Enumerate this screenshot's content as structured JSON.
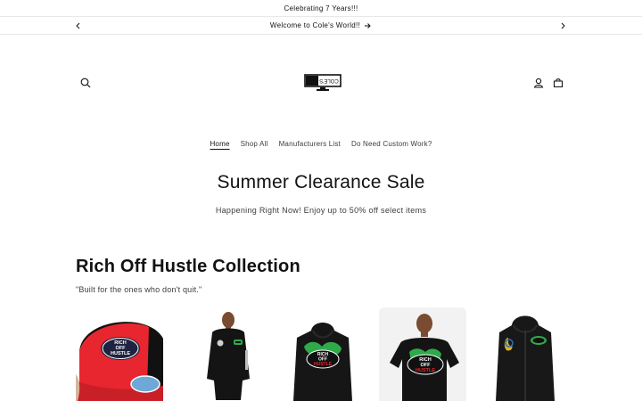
{
  "announcement_1": "Celebrating 7 Years!!!",
  "announcement_2": "Welcome to Cole's World!!",
  "nav": {
    "items": [
      {
        "label": "Home"
      },
      {
        "label": "Shop All"
      },
      {
        "label": "Manufacturers List"
      },
      {
        "label": "Do Need Custom Work?"
      }
    ]
  },
  "logo": {
    "text": "COLE'S"
  },
  "banner": {
    "title": "Summer Clearance Sale",
    "subtitle": "Happening Right Now! Enjoy up to 50% off select items"
  },
  "collection": {
    "title": "Rich Off Hustle Collection",
    "subtitle": "\"Built for the ones who don't quit.\"",
    "products": [
      {
        "name": "hat",
        "print_text": [
          "RICH",
          "OFF",
          "HUSTLE"
        ]
      },
      {
        "name": "model-hoodie-black",
        "print_text": []
      },
      {
        "name": "hoodie-black-green",
        "print_text": [
          "RICH",
          "OFF",
          "HUSTLE"
        ]
      },
      {
        "name": "model-tee-black",
        "print_text": [
          "RICH",
          "OFF",
          "HUSTLE"
        ]
      },
      {
        "name": "zip-hoodie-black",
        "print_text": []
      }
    ]
  },
  "colors": {
    "text": "#121212",
    "muted": "#3d3d3d",
    "border": "#e8e8e8",
    "hat_red": "#e8262f",
    "accent_green": "#2faa4a"
  },
  "icons": [
    "chevron-left-icon",
    "chevron-right-icon",
    "arrow-right-icon",
    "search-icon",
    "account-icon",
    "cart-icon"
  ]
}
